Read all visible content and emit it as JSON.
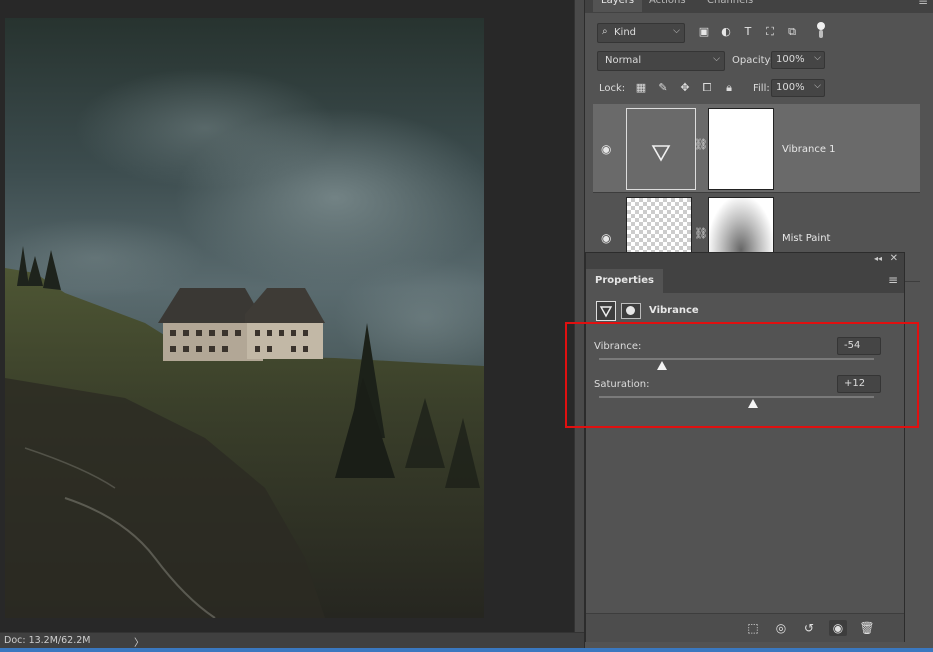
{
  "canvas": {
    "status": "Doc: 13.2M/62.2M",
    "status_arrow": "〉"
  },
  "layers_panel": {
    "tabs": [
      "Layers",
      "Actions",
      "Channels"
    ],
    "kind_label": "Kind",
    "blend_mode": "Normal",
    "opacity_label": "Opacity:",
    "opacity_value": "100%",
    "lock_label": "Lock:",
    "fill_label": "Fill:",
    "fill_value": "100%",
    "layers": [
      {
        "name": "Vibrance 1",
        "selected": true,
        "type": "adjustment"
      },
      {
        "name": "Mist Paint",
        "selected": false,
        "type": "pixel"
      }
    ]
  },
  "properties_panel": {
    "tab": "Properties",
    "adjustment_title": "Vibrance",
    "vibrance_label": "Vibrance:",
    "vibrance_value": "-54",
    "vibrance_fraction": 0.23,
    "saturation_label": "Saturation:",
    "saturation_value": "+12",
    "saturation_fraction": 0.56
  },
  "colors": {
    "highlight": "#e01010",
    "panel_bg": "#535353",
    "selected_row": "#6a6a6a"
  }
}
